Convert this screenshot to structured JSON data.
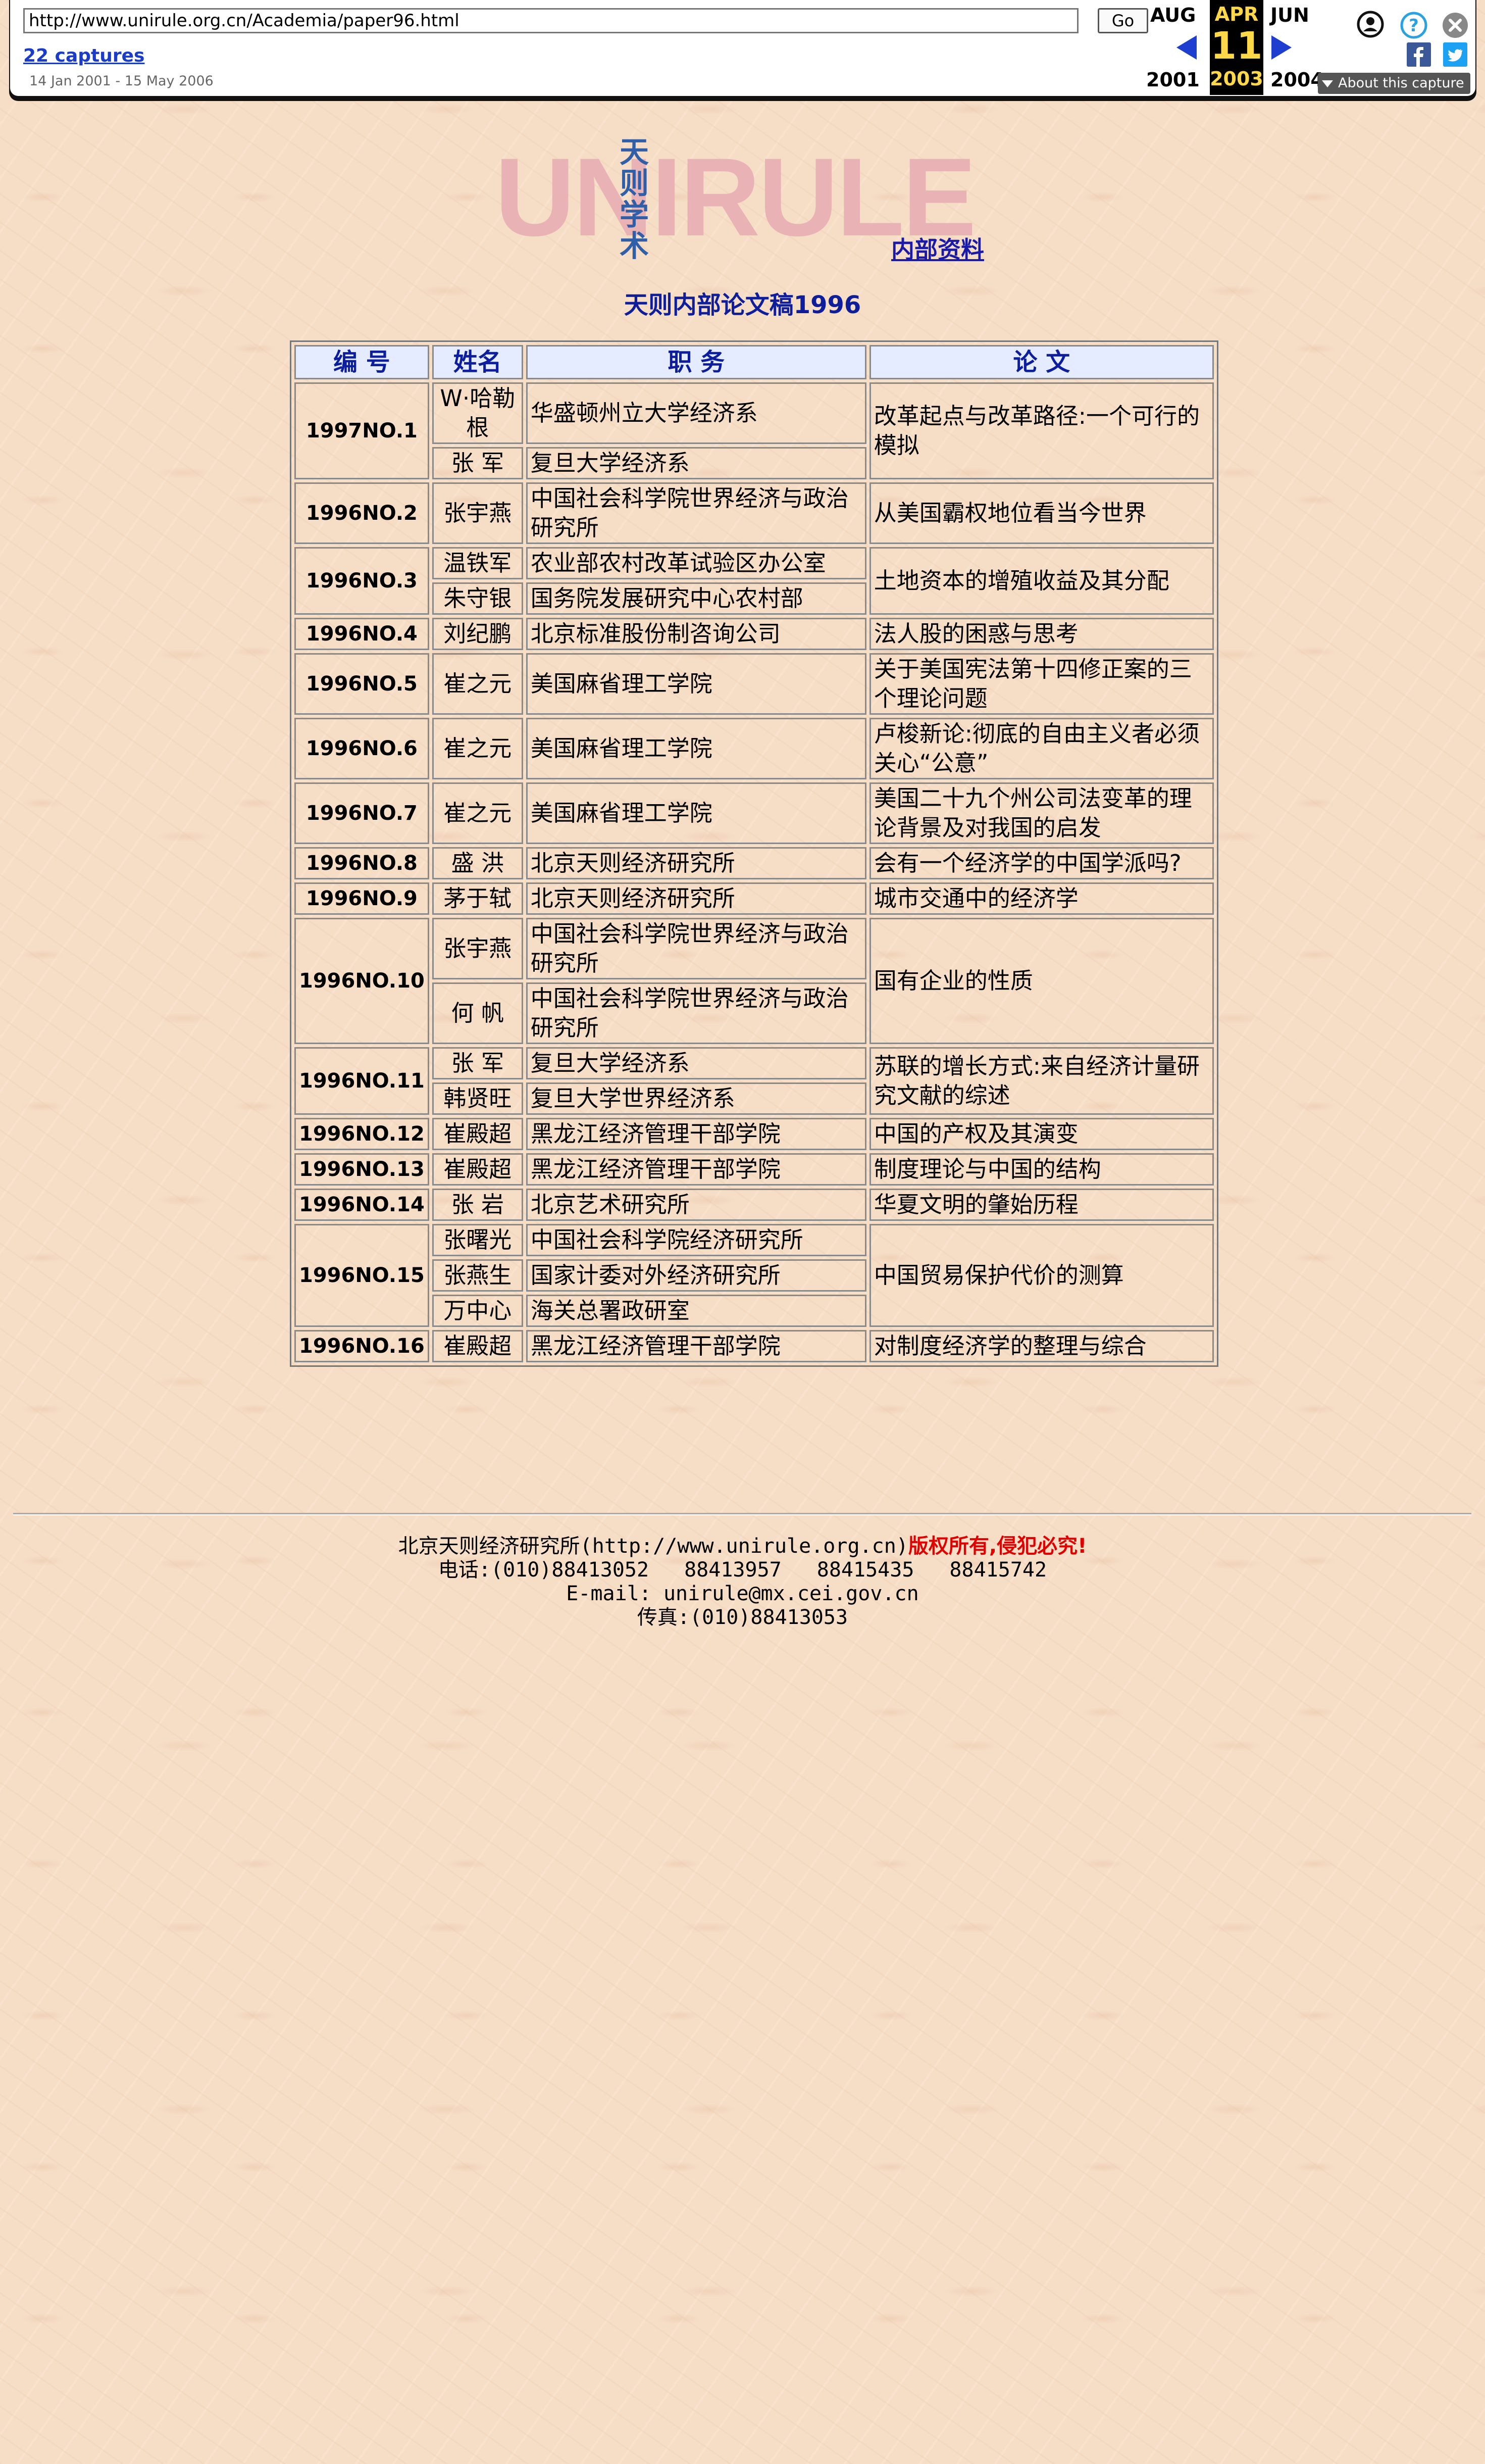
{
  "wayback": {
    "url": "http://www.unirule.org.cn/Academia/paper96.html",
    "go_label": "Go",
    "captures_label": "22 captures",
    "date_range": "14 Jan 2001 - 15 May 2006",
    "prev_month": "AUG",
    "current_month": "APR",
    "next_month": "JUN",
    "current_day": "11",
    "prev_year": "2001",
    "current_year": "2003",
    "next_year": "2004",
    "about_label": "About this capture"
  },
  "logo": {
    "text": "UNIRULE",
    "chinese": [
      "天",
      "则",
      "学",
      "术"
    ]
  },
  "nav": {
    "internal_link": "内部资料"
  },
  "page_title": "天则内部论文稿1996",
  "table": {
    "headers": [
      "编 号",
      "姓名",
      "职 务",
      "论 文"
    ],
    "rows": [
      {
        "no": "1997NO.1",
        "authors": [
          {
            "name": "W·哈勒根",
            "aff": "华盛顿州立大学经济系"
          },
          {
            "name": "张 军",
            "aff": "复旦大学经济系"
          }
        ],
        "title": "改革起点与改革路径:一个可行的模拟"
      },
      {
        "no": "1996NO.2",
        "authors": [
          {
            "name": "张宇燕",
            "aff": "中国社会科学院世界经济与政治研究所"
          }
        ],
        "title": "从美国霸权地位看当今世界"
      },
      {
        "no": "1996NO.3",
        "authors": [
          {
            "name": "温铁军",
            "aff": "农业部农村改革试验区办公室"
          },
          {
            "name": "朱守银",
            "aff": "国务院发展研究中心农村部"
          }
        ],
        "title": "土地资本的增殖收益及其分配"
      },
      {
        "no": "1996NO.4",
        "authors": [
          {
            "name": "刘纪鹏",
            "aff": "北京标准股份制咨询公司"
          }
        ],
        "title": "法人股的困惑与思考"
      },
      {
        "no": "1996NO.5",
        "authors": [
          {
            "name": "崔之元",
            "aff": "美国麻省理工学院"
          }
        ],
        "title": "关于美国宪法第十四修正案的三个理论问题"
      },
      {
        "no": "1996NO.6",
        "authors": [
          {
            "name": "崔之元",
            "aff": "美国麻省理工学院"
          }
        ],
        "title": "卢梭新论:彻底的自由主义者必须关心“公意”"
      },
      {
        "no": "1996NO.7",
        "authors": [
          {
            "name": "崔之元",
            "aff": "美国麻省理工学院"
          }
        ],
        "title": "美国二十九个州公司法变革的理论背景及对我国的启发"
      },
      {
        "no": "1996NO.8",
        "authors": [
          {
            "name": "盛 洪",
            "aff": "北京天则经济研究所"
          }
        ],
        "title": "会有一个经济学的中国学派吗?"
      },
      {
        "no": "1996NO.9",
        "authors": [
          {
            "name": "茅于轼",
            "aff": "北京天则经济研究所"
          }
        ],
        "title": "城市交通中的经济学"
      },
      {
        "no": "1996NO.10",
        "authors": [
          {
            "name": "张宇燕",
            "aff": "中国社会科学院世界经济与政治研究所"
          },
          {
            "name": "何 帆",
            "aff": "中国社会科学院世界经济与政治研究所"
          }
        ],
        "title": "国有企业的性质"
      },
      {
        "no": "1996NO.11",
        "authors": [
          {
            "name": "张 军",
            "aff": "复旦大学经济系"
          },
          {
            "name": "韩贤旺",
            "aff": "复旦大学世界经济系"
          }
        ],
        "title": "苏联的增长方式:来自经济计量研究文献的综述"
      },
      {
        "no": "1996NO.12",
        "authors": [
          {
            "name": "崔殿超",
            "aff": "黑龙江经济管理干部学院"
          }
        ],
        "title": "中国的产权及其演变"
      },
      {
        "no": "1996NO.13",
        "authors": [
          {
            "name": "崔殿超",
            "aff": "黑龙江经济管理干部学院"
          }
        ],
        "title": "制度理论与中国的结构"
      },
      {
        "no": "1996NO.14",
        "authors": [
          {
            "name": "张 岩",
            "aff": "北京艺术研究所"
          }
        ],
        "title": "华夏文明的肇始历程"
      },
      {
        "no": "1996NO.15",
        "authors": [
          {
            "name": "张曙光",
            "aff": "中国社会科学院经济研究所"
          },
          {
            "name": "张燕生",
            "aff": "国家计委对外经济研究所"
          },
          {
            "name": "万中心",
            "aff": "海关总署政研室"
          }
        ],
        "title": "中国贸易保护代价的测算"
      },
      {
        "no": "1996NO.16",
        "authors": [
          {
            "name": "崔殿超",
            "aff": "黑龙江经济管理干部学院"
          }
        ],
        "title": "对制度经济学的整理与综合"
      }
    ]
  },
  "footer": {
    "org": "北京天则经济研究所(http://www.unirule.org.cn)",
    "copyright": "版权所有,侵犯必究",
    "copyright_end": "!",
    "phone_label": "电话:",
    "phones": [
      "(010)88413052",
      "88413957",
      "88415435",
      "88415742"
    ],
    "email": "E-mail: unirule@mx.cei.gov.cn",
    "fax": "传真:(010)88413053"
  },
  "colors": {
    "background": "#f6ddc6",
    "header_blue": "#0c1d9e",
    "logo_pink": "#e9b3b6",
    "wayback_yellow": "#ffd84a"
  }
}
